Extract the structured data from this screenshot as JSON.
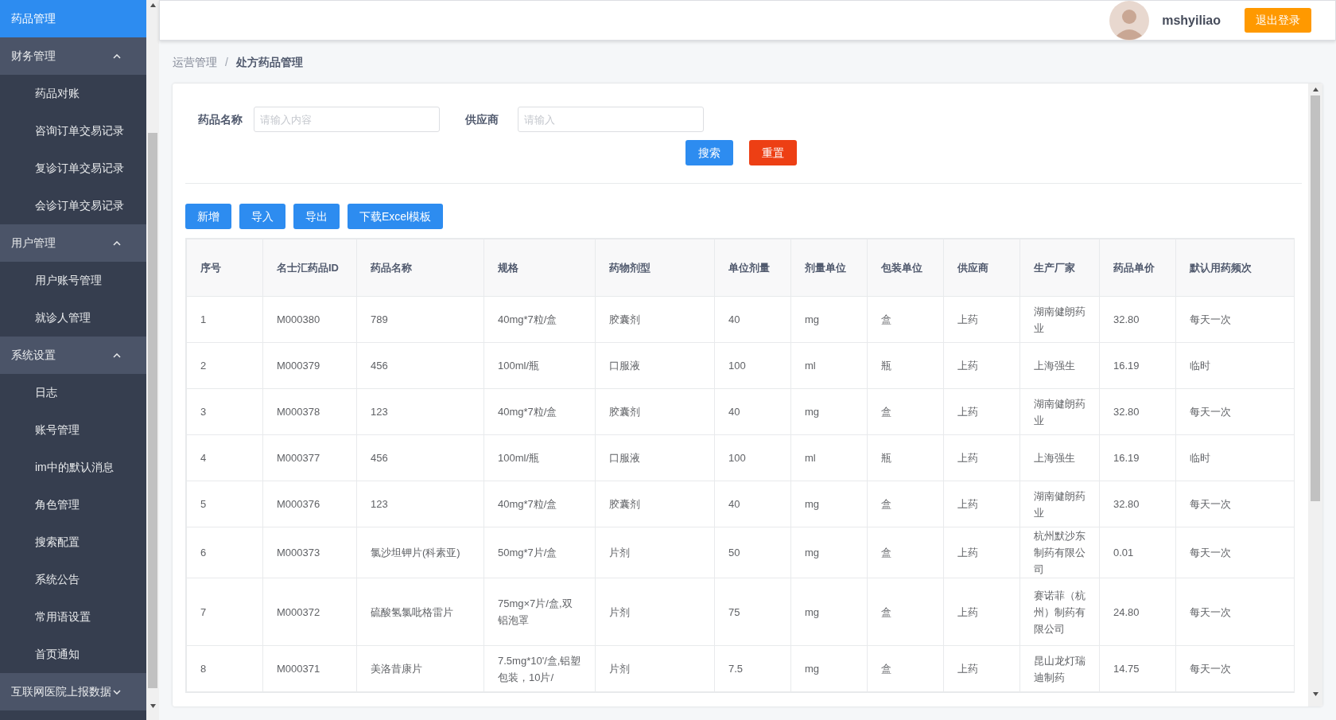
{
  "sidebar": {
    "items": [
      {
        "label": "药品管理",
        "selected": true
      },
      {
        "label": "财务管理",
        "selected": false,
        "expanded": true,
        "children": [
          {
            "label": "药品对账",
            "selected": false
          },
          {
            "label": "咨询订单交易记录",
            "selected": false
          },
          {
            "label": "复诊订单交易记录",
            "selected": false
          },
          {
            "label": "会诊订单交易记录",
            "selected": false
          }
        ]
      },
      {
        "label": "用户管理",
        "selected": false,
        "expanded": true,
        "children": [
          {
            "label": "用户账号管理",
            "selected": false
          },
          {
            "label": "就诊人管理",
            "selected": false
          }
        ]
      },
      {
        "label": "系统设置",
        "selected": false,
        "expanded": true,
        "children": [
          {
            "label": "日志",
            "selected": false
          },
          {
            "label": "账号管理",
            "selected": false
          },
          {
            "label": "im中的默认消息",
            "selected": false
          },
          {
            "label": "角色管理",
            "selected": false
          },
          {
            "label": "搜索配置",
            "selected": false
          },
          {
            "label": "系统公告",
            "selected": false
          },
          {
            "label": "常用语设置",
            "selected": false
          },
          {
            "label": "首页通知",
            "selected": false
          }
        ]
      },
      {
        "label": "互联网医院上报数据",
        "selected": false,
        "expanded": false
      }
    ]
  },
  "header": {
    "username": "mshyiliao",
    "logout_button": "退出登录"
  },
  "breadcrumb": {
    "separator": "/",
    "items": [
      "运营管理",
      "处方药品管理"
    ]
  },
  "search_form": {
    "fields": [
      {
        "label": "药品名称",
        "placeholder": "请输入内容"
      },
      {
        "label": "供应商",
        "placeholder": "请输入"
      }
    ],
    "buttons": [
      {
        "label": "搜索",
        "kind": "primary"
      },
      {
        "label": "重置",
        "kind": "danger"
      }
    ]
  },
  "toolbar": [
    "新增",
    "导入",
    "导出",
    "下载Excel模板"
  ],
  "table": {
    "columns": [
      "序号",
      "名士汇药品ID",
      "药品名称",
      "规格",
      "药物剂型",
      "单位剂量",
      "剂量单位",
      "包装单位",
      "供应商",
      "生产厂家",
      "药品单价",
      "默认用药频次"
    ],
    "rows": [
      [
        "1",
        "M000380",
        "789",
        "40mg*7粒/盒",
        "胶囊剂",
        "40",
        "mg",
        "盒",
        "上药",
        "湖南健朗药业",
        "32.80",
        "每天一次"
      ],
      [
        "2",
        "M000379",
        "456",
        "100ml/瓶",
        "口服液",
        "100",
        "ml",
        "瓶",
        "上药",
        "上海强生",
        "16.19",
        "临时"
      ],
      [
        "3",
        "M000378",
        "123",
        "40mg*7粒/盒",
        "胶囊剂",
        "40",
        "mg",
        "盒",
        "上药",
        "湖南健朗药业",
        "32.80",
        "每天一次"
      ],
      [
        "4",
        "M000377",
        "456",
        "100ml/瓶",
        "口服液",
        "100",
        "ml",
        "瓶",
        "上药",
        "上海强生",
        "16.19",
        "临时"
      ],
      [
        "5",
        "M000376",
        "123",
        "40mg*7粒/盒",
        "胶囊剂",
        "40",
        "mg",
        "盒",
        "上药",
        "湖南健朗药业",
        "32.80",
        "每天一次"
      ],
      [
        "6",
        "M000373",
        "氯沙坦钾片(科素亚)",
        "50mg*7片/盒",
        "片剂",
        "50",
        "mg",
        "盒",
        "上药",
        "杭州默沙东制药有限公司",
        "0.01",
        "每天一次"
      ],
      [
        "7",
        "M000372",
        "硫酸氢氯吡格雷片",
        "75mg×7片/盒,双铝泡罩",
        "片剂",
        "75",
        "mg",
        "盒",
        "上药",
        "赛诺菲（杭州）制药有限公司",
        "24.80",
        "每天一次"
      ],
      [
        "8",
        "M000371",
        "美洛昔康片",
        "7.5mg*10'/盒,铝塑包装，10片/",
        "片剂",
        "7.5",
        "mg",
        "盒",
        "上药",
        "昆山龙灯瑞迪制药",
        "14.75",
        "每天一次"
      ]
    ]
  }
}
